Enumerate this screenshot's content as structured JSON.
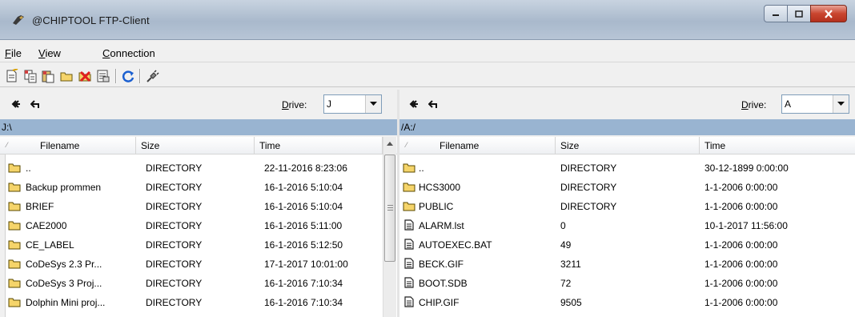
{
  "window": {
    "title": "@CHIPTOOL FTP-Client"
  },
  "menu": {
    "items": [
      {
        "label": "File",
        "mnemonic": "F"
      },
      {
        "label": "View",
        "mnemonic": "V"
      },
      {
        "label": "Connection",
        "mnemonic": "C"
      }
    ]
  },
  "toolbar": {
    "icons": [
      "new-file-icon",
      "copy-icon",
      "paste-icon",
      "new-folder-icon",
      "delete-icon",
      "properties-icon",
      "refresh-icon",
      "connect-plug-icon"
    ]
  },
  "left_pane": {
    "drive_label": "Drive:",
    "drive_mnemonic": "D",
    "drive_value": "J",
    "path": "J:\\",
    "columns": [
      "Filename",
      "Size",
      "Time"
    ],
    "rows": [
      {
        "name": "..",
        "size": "DIRECTORY",
        "time": "22-11-2016 8:23:06"
      },
      {
        "name": "Backup prommen",
        "size": "DIRECTORY",
        "time": "16-1-2016 5:10:04"
      },
      {
        "name": "BRIEF",
        "size": "DIRECTORY",
        "time": "16-1-2016 5:10:04"
      },
      {
        "name": "CAE2000",
        "size": "DIRECTORY",
        "time": "16-1-2016 5:11:00"
      },
      {
        "name": "CE_LABEL",
        "size": "DIRECTORY",
        "time": "16-1-2016 5:12:50"
      },
      {
        "name": "CoDeSys 2.3 Pr...",
        "size": "DIRECTORY",
        "time": "17-1-2017 10:01:00"
      },
      {
        "name": "CoDeSys 3 Proj...",
        "size": "DIRECTORY",
        "time": "16-1-2016 7:10:34"
      },
      {
        "name": "Dolphin Mini proj...",
        "size": "DIRECTORY",
        "time": "16-1-2016 7:10:34"
      }
    ]
  },
  "right_pane": {
    "drive_label": "Drive:",
    "drive_mnemonic": "D",
    "drive_value": "A",
    "path": "/A:/",
    "columns": [
      "Filename",
      "Size",
      "Time"
    ],
    "rows": [
      {
        "name": "..",
        "size": "DIRECTORY",
        "time": "30-12-1899 0:00:00",
        "kind": "folder"
      },
      {
        "name": "HCS3000",
        "size": "DIRECTORY",
        "time": "1-1-2006 0:00:00",
        "kind": "folder"
      },
      {
        "name": "PUBLIC",
        "size": "DIRECTORY",
        "time": "1-1-2006 0:00:00",
        "kind": "folder"
      },
      {
        "name": "ALARM.lst",
        "size": "0",
        "time": "10-1-2017 11:56:00",
        "kind": "file"
      },
      {
        "name": "AUTOEXEC.BAT",
        "size": "49",
        "time": "1-1-2006 0:00:00",
        "kind": "file"
      },
      {
        "name": "BECK.GIF",
        "size": "3211",
        "time": "1-1-2006 0:00:00",
        "kind": "file"
      },
      {
        "name": "BOOT.SDB",
        "size": "72",
        "time": "1-1-2006 0:00:00",
        "kind": "file"
      },
      {
        "name": "CHIP.GIF",
        "size": "9505",
        "time": "1-1-2006 0:00:00",
        "kind": "file"
      }
    ]
  },
  "colors": {
    "path_bar": "#99b4d1",
    "folder": "#f5d46a",
    "close_button": "#c9452f"
  }
}
